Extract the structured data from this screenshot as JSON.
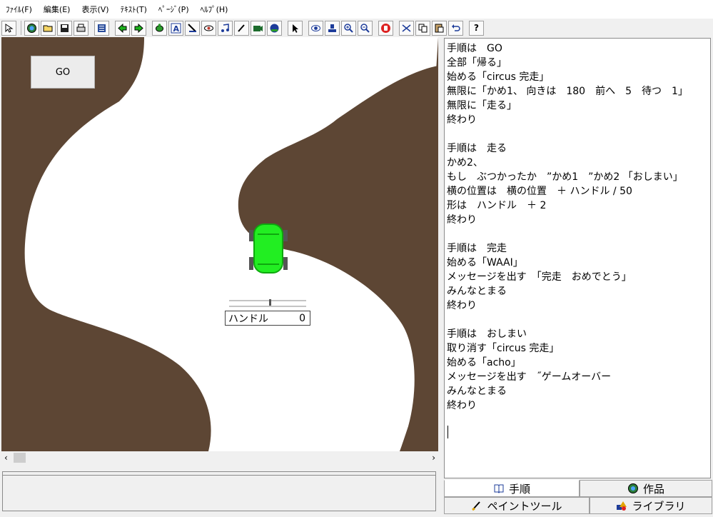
{
  "menu": {
    "items": [
      "ﾌｧｲﾙ(F)",
      "編集(E)",
      "表示(V)",
      "ﾃｷｽﾄ(T)",
      "ﾍﾟｰｼﾞ(P)",
      "ﾍﾙﾌﾟ(H)"
    ]
  },
  "toolbar": {
    "buttons": [
      "pointer-arrow-icon",
      "globe-icon",
      "open-folder-icon",
      "save-icon",
      "print-icon",
      "list-icon",
      "back-arrow-icon",
      "forward-arrow-icon",
      "turtle-icon",
      "text-a-icon",
      "cursor-pen-icon",
      "eye-icon",
      "music-note-icon",
      "brush-icon",
      "camera-icon",
      "ball-icon",
      "select-arrow-icon",
      "view-eye-icon",
      "stamp-icon",
      "zoom-in-icon",
      "zoom-out-icon",
      "stop-hand-icon",
      "cut-icon",
      "copy-icon",
      "paste-icon",
      "undo-icon",
      "help-icon"
    ],
    "help_label": "?"
  },
  "stage": {
    "go_button_label": "GO",
    "slider_label": "ハンドル",
    "slider_value": "0",
    "colors": {
      "ground": "#5d4634",
      "road": "#ffffff",
      "car": "#22ee22"
    }
  },
  "editor": {
    "lines": [
      "手順は　GO",
      "全部「帰る」",
      "始める「circus 完走」",
      "無限に「かめ1、 向きは　180　前へ　5　待つ　1」",
      "無限に「走る」",
      "終わり",
      "",
      "手順は　走る",
      "かめ2、",
      "もし　ぶつかったか　”かめ1　”かめ2 「おしまい」",
      "横の位置は　横の位置　＋ ハンドル / 50",
      "形は　ハンドル　＋ 2",
      "終わり",
      "",
      "手順は　完走",
      "始める「WAAI」",
      "メッセージを出す　「完走　おめでとう」",
      "みんなとまる",
      "終わり",
      "",
      "手順は　おしまい",
      "取り消す「circus 完走」",
      "始める「acho」",
      "メッセージを出す　˝ゲームオーバー",
      "みんなとまる",
      "終わり"
    ]
  },
  "tabs": {
    "procedure": "手順",
    "works": "作品",
    "paint": "ペイントツール",
    "library": "ライブラリ"
  }
}
